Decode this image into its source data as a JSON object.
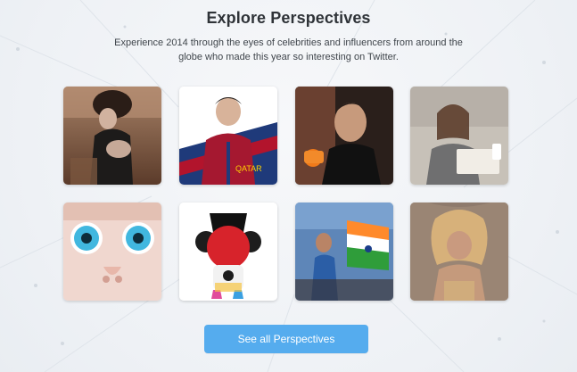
{
  "header": {
    "title": "Explore Perspectives",
    "subtitle": "Experience 2014 through the eyes of celebrities and influencers from around the globe who made this year so interesting on Twitter."
  },
  "grid": {
    "tiles": [
      {
        "name": "portrait-woman-curly-hair"
      },
      {
        "name": "portrait-football-player"
      },
      {
        "name": "portrait-man-interview"
      },
      {
        "name": "portrait-woman-writer"
      },
      {
        "name": "closeup-cartoon-eyes"
      },
      {
        "name": "toy-figure-headphones"
      },
      {
        "name": "cricket-player-flag"
      },
      {
        "name": "portrait-woman-blonde"
      }
    ]
  },
  "cta": {
    "label": "See all Perspectives"
  },
  "colors": {
    "accent": "#55acee",
    "title": "#2f3338",
    "text": "#3f454b"
  }
}
